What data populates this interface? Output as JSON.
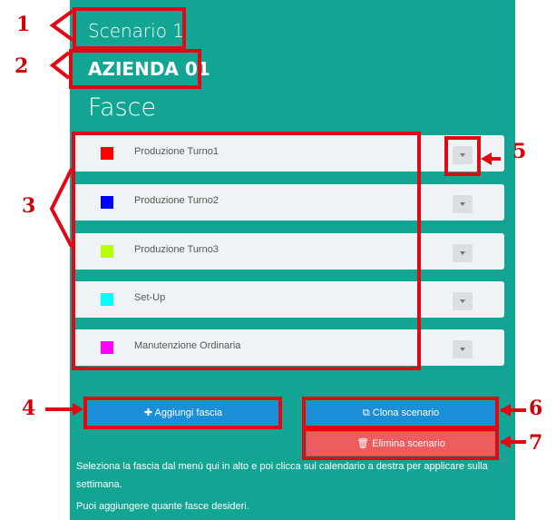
{
  "header": {
    "scenario": "Scenario 1",
    "company": "AZIENDA 01",
    "section": "Fasce"
  },
  "fasce": [
    {
      "label": "Produzione Turno1",
      "color": "#ff0000"
    },
    {
      "label": "Produzione Turno2",
      "color": "#0000ff"
    },
    {
      "label": "Produzione Turno3",
      "color": "#b5ff00"
    },
    {
      "label": "Set-Up",
      "color": "#00ffff"
    },
    {
      "label": "Manutenzione Ordinaria",
      "color": "#ff00ff"
    }
  ],
  "buttons": {
    "add": "Aggiungi fascia",
    "clone": "Clona scenario",
    "delete": "Elimina scenario"
  },
  "help": {
    "line1": "Seleziona la fascia dal menù qui in alto e poi clicca sul calendario a destra per applicare sulla settimana.",
    "line2": "Puoi aggiungere quante fasce desideri."
  },
  "annotations": [
    "1",
    "2",
    "3",
    "4",
    "5",
    "6",
    "7"
  ],
  "colors": {
    "panel": "#13a594",
    "annotation": "#e30613"
  }
}
